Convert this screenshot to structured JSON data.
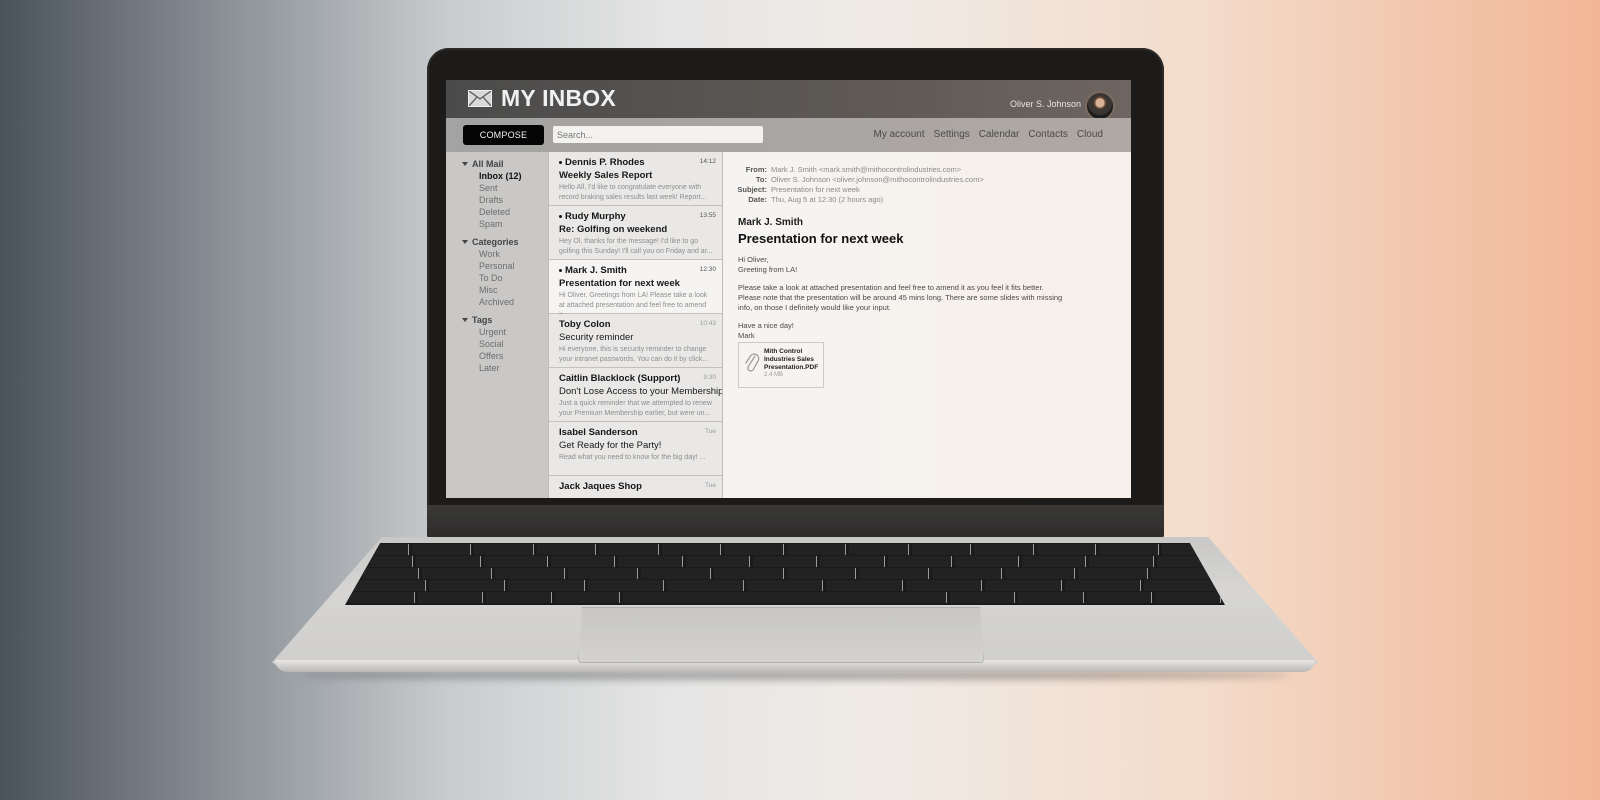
{
  "app": {
    "title": "MY INBOX",
    "user_name": "Oliver S. Johnson"
  },
  "toolbar": {
    "compose_label": "COMPOSE",
    "search_placeholder": "Search...",
    "nav": [
      "My account",
      "Settings",
      "Calendar",
      "Contacts",
      "Cloud"
    ]
  },
  "sidebar": {
    "groups": [
      {
        "label": "All Mail",
        "items": [
          {
            "label": "Inbox (12)",
            "active": true
          },
          {
            "label": "Sent"
          },
          {
            "label": "Drafts"
          },
          {
            "label": "Deleted"
          },
          {
            "label": "Spam"
          }
        ]
      },
      {
        "label": "Categories",
        "items": [
          {
            "label": "Work"
          },
          {
            "label": "Personal"
          },
          {
            "label": "To Do"
          },
          {
            "label": "Misc"
          },
          {
            "label": "Archived"
          }
        ]
      },
      {
        "label": "Tags",
        "items": [
          {
            "label": "Urgent"
          },
          {
            "label": "Social"
          },
          {
            "label": "Offers"
          },
          {
            "label": "Later"
          }
        ]
      }
    ]
  },
  "messages": [
    {
      "sender": "Dennis P. Rhodes",
      "subject": "Weekly Sales Report",
      "time": "14:12",
      "unread": true,
      "preview": "Hello All, I'd like to congratulate everyone with record braking sales results last week! Report..."
    },
    {
      "sender": "Rudy Murphy",
      "subject": "Re: Golfing on weekend",
      "time": "13:55",
      "unread": true,
      "preview": "Hey Ol, thanks for the message! I'd like to go golfing this Sunday! I'll call you on Friday and ar..."
    },
    {
      "sender": "Mark J. Smith",
      "subject": "Presentation for next week",
      "time": "12:30",
      "unread": true,
      "selected": true,
      "preview": "Hi Oliver, Greetings from LA! Please take a look at attached presentation and feel free to amend it..."
    },
    {
      "sender": "Toby Colon",
      "subject": "Security reminder",
      "time": "10:43",
      "unread": false,
      "preview": "Hi everyone, this is security reminder to change your intranet passwords. You can do it by click..."
    },
    {
      "sender": "Caitlin Blacklock (Support)",
      "subject": "Don't Lose Access to your Membership",
      "time": "9:30",
      "unread": false,
      "preview": "Just a quick reminder that we attempted to renew your Premium Membership earlier, but were un..."
    },
    {
      "sender": "Isabel Sanderson",
      "subject": "Get Ready for the Party!",
      "time": "Tue",
      "unread": false,
      "preview": "Read what you need to know for the big day! ..."
    },
    {
      "sender": "Jack Jaques Shop",
      "subject": "",
      "time": "Tue",
      "unread": false,
      "preview": ""
    }
  ],
  "reader": {
    "meta": [
      {
        "label": "From:",
        "value": "Mark J. Smith <mark.smith@mithocontrolindustries.com>"
      },
      {
        "label": "To:",
        "value": "Oliver S. Johnson <oliver.johnson@mithocontrolindustries.com>"
      },
      {
        "label": "Subject:",
        "value": "Presentation for next week"
      },
      {
        "label": "Date:",
        "value": "Thu, Aug 5 at 12:30 (2 hours ago)"
      }
    ],
    "sender": "Mark J. Smith",
    "subject": "Presentation for next week",
    "body": [
      "Hi Oliver,\nGreeting from LA!",
      "Please take a look at attached presentation and feel free to amend it as you feel it fits better.\nPlease note that the presentation will be around 45 mins long. There are some slides with missing\ninfo, on those I definitely would like your input.",
      "Have a nice day!\nMark"
    ],
    "attachment": {
      "name": "Mith Control Industries Sales Presentation.PDF",
      "size": "2.4 MB",
      "icon": "paperclip-icon"
    }
  },
  "icons": {
    "logo": "envelope-icon",
    "avatar": "user-avatar",
    "group_toggle": "triangle-down-icon"
  }
}
